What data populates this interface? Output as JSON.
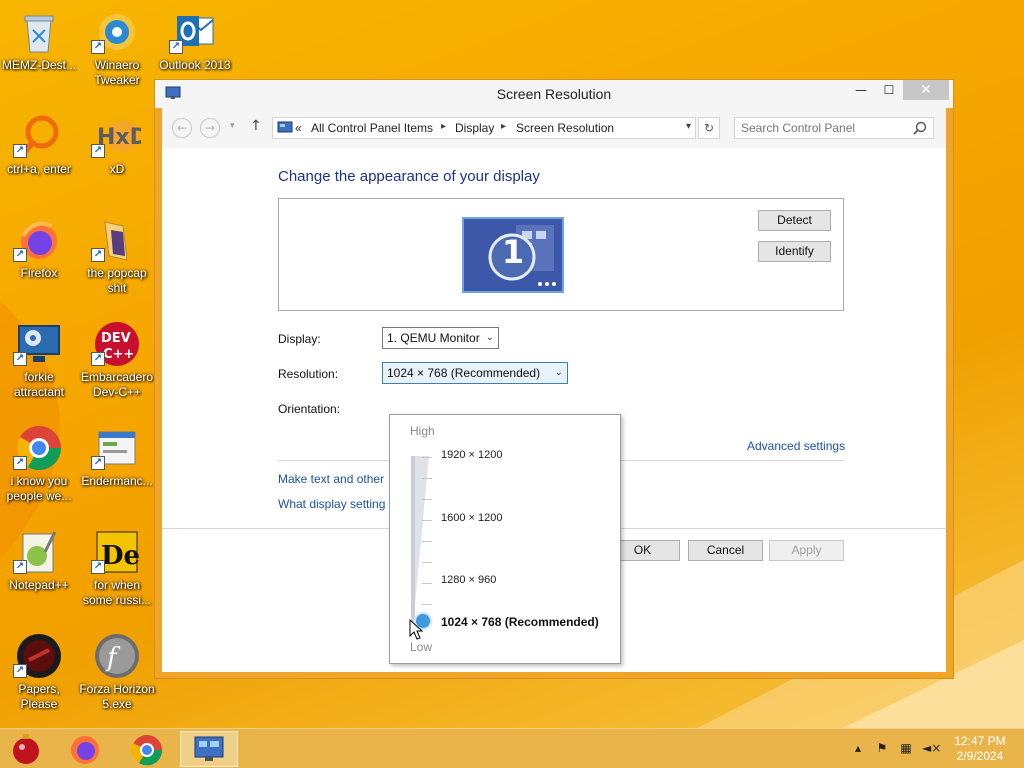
{
  "desktop": {
    "icons": [
      {
        "label": "MEMZ-Dest...",
        "icon": "recycle-bin-icon"
      },
      {
        "label": "Winaero Tweaker",
        "icon": "winaero-tweaker-icon"
      },
      {
        "label": "Outlook 2013",
        "icon": "outlook-icon"
      },
      {
        "label": "ctrl+a, enter",
        "icon": "magnifier-icon"
      },
      {
        "label": "xD",
        "icon": "hxd-icon"
      },
      {
        "label": "Firefox",
        "icon": "firefox-icon"
      },
      {
        "label": "the popcap shit",
        "icon": "folder-icon"
      },
      {
        "label": "forkie attractant",
        "icon": "monitor-settings-icon"
      },
      {
        "label": "Embarcadero Dev-C++",
        "icon": "devcpp-icon"
      },
      {
        "label": "i know you people we...",
        "icon": "chrome-icon"
      },
      {
        "label": "Endermanc...",
        "icon": "window-app-icon"
      },
      {
        "label": "Notepad++",
        "icon": "notepadpp-icon"
      },
      {
        "label": "for when some russi...",
        "icon": "die-icon"
      },
      {
        "label": "Papers, Please",
        "icon": "papers-please-icon"
      },
      {
        "label": "Forza Horizon 5.exe",
        "icon": "flash-icon"
      }
    ]
  },
  "window": {
    "title": "Screen Resolution",
    "controls": {
      "minimize": "—",
      "maximize": "☐",
      "close": "✕"
    },
    "address": {
      "prefix": "«",
      "crumbs": [
        "All Control Panel Items",
        "Display",
        "Screen Resolution"
      ],
      "search_placeholder": "Search Control Panel"
    },
    "heading": "Change the appearance of your display",
    "monitor_number": "1",
    "detect_label": "Detect",
    "identify_label": "Identify",
    "display_label": "Display:",
    "display_value": "1. QEMU Monitor",
    "resolution_label": "Resolution:",
    "resolution_value": "1024 × 768 (Recommended)",
    "orientation_label": "Orientation:",
    "advanced_link": "Advanced settings",
    "link_text_size": "Make text and other",
    "link_display_settings": "What display setting",
    "ok_label": "OK",
    "cancel_label": "Cancel",
    "apply_label": "Apply"
  },
  "resolution_popup": {
    "high_label": "High",
    "low_label": "Low",
    "options": [
      "1920 × 1200",
      "1600 × 1200",
      "1280 × 960",
      "1024 × 768 (Recommended)"
    ],
    "selected": "1024 × 768 (Recommended)"
  },
  "taskbar": {
    "items": [
      "memz-ornament-icon",
      "firefox-icon",
      "chrome-icon",
      "control-panel-icon"
    ],
    "active_item": "control-panel-icon",
    "time": "12:47 PM",
    "date": "2/9/2024"
  },
  "colors": {
    "wallpaper": "#f5a300",
    "heading": "#1e3287",
    "link": "#1c52a4",
    "slider_thumb": "#3f9ae0"
  }
}
